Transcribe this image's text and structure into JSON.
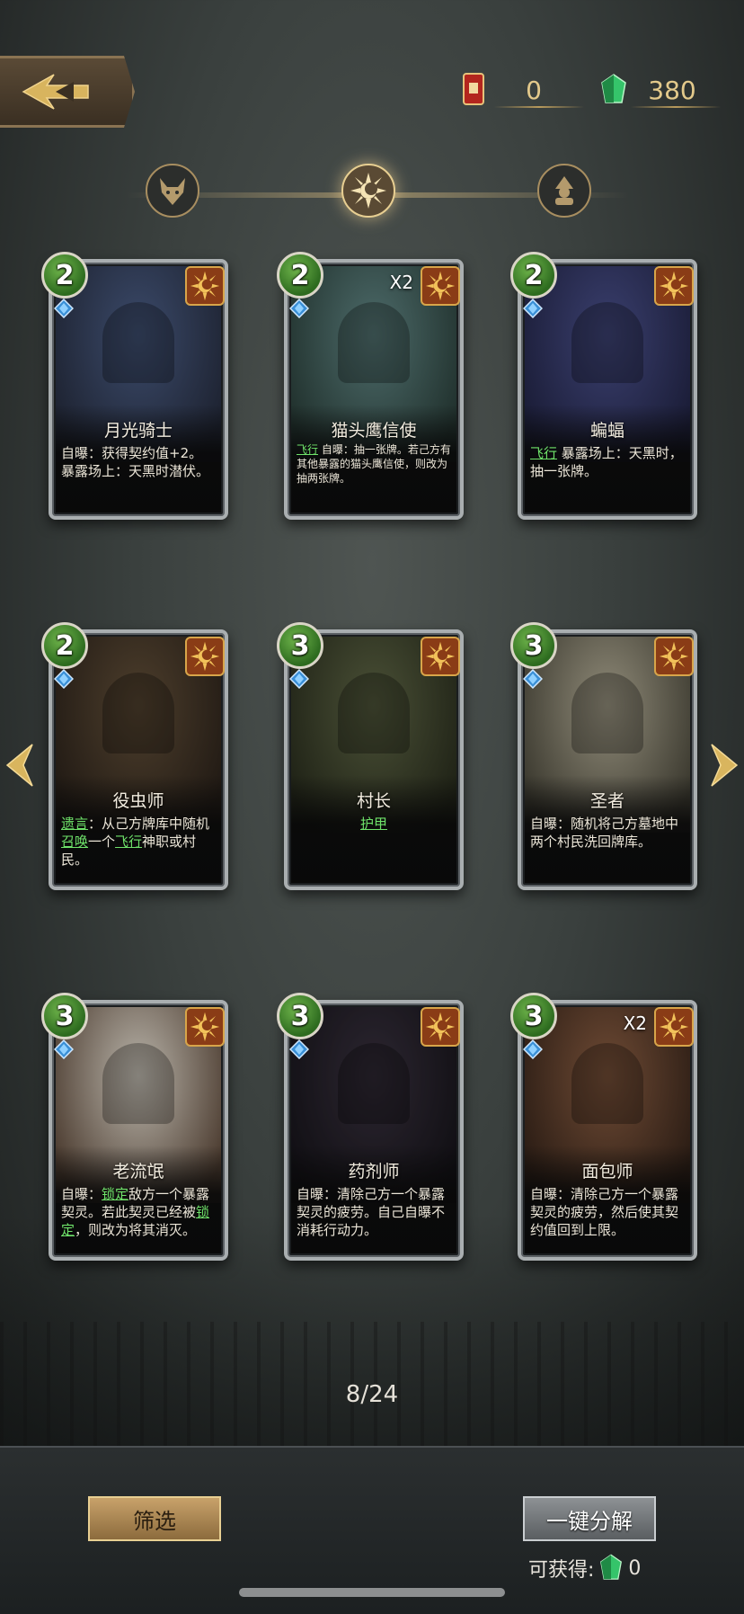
{
  "header": {
    "back_icon": "back-arrow-icon",
    "card_pack": {
      "icon": "card-pack-icon",
      "value": "0"
    },
    "gems": {
      "icon": "green-gem-icon",
      "value": "380"
    }
  },
  "faction_filters": [
    {
      "icon": "wolf-icon",
      "active": false
    },
    {
      "icon": "sun-moon-icon",
      "active": true
    },
    {
      "icon": "villager-icon",
      "active": false
    }
  ],
  "cards": [
    {
      "cost": "2",
      "name": "月光骑士",
      "multiplier": "",
      "desc": [
        {
          "t": "自曝：获得契约值+2。暴露场上：天黑时潜伏。",
          "k": false
        }
      ],
      "art": [
        "#3b4a6a",
        "#1d2230"
      ]
    },
    {
      "cost": "2",
      "name": "猫头鹰信使",
      "multiplier": "X2",
      "desc": [
        {
          "t": "飞行",
          "k": true
        },
        {
          "t": " 自曝：抽一张牌。若己方有其他暴露的猫头鹰信使，则改为抽两张牌。",
          "k": false
        }
      ],
      "small": true,
      "art": [
        "#4d6b6a",
        "#20302c"
      ]
    },
    {
      "cost": "2",
      "name": "蝙蝠",
      "multiplier": "",
      "desc": [
        {
          "t": "飞行",
          "k": true
        },
        {
          "t": " 暴露场上：天黑时，抽一张牌。",
          "k": false
        }
      ],
      "art": [
        "#3a3f6e",
        "#1a1c36"
      ]
    },
    {
      "cost": "2",
      "name": "役虫师",
      "multiplier": "",
      "desc": [
        {
          "t": "遗言",
          "k": true
        },
        {
          "t": "：从己方牌库中随机",
          "k": false
        },
        {
          "t": "召唤",
          "k": true
        },
        {
          "t": "一个",
          "k": false
        },
        {
          "t": "飞行",
          "k": true
        },
        {
          "t": "神职或村民。",
          "k": false
        }
      ],
      "art": [
        "#4d3e2c",
        "#211a14"
      ]
    },
    {
      "cost": "3",
      "name": "村长",
      "multiplier": "",
      "desc": [
        {
          "t": "护甲",
          "k": true
        }
      ],
      "center": true,
      "art": [
        "#4a5036",
        "#1f2216"
      ]
    },
    {
      "cost": "3",
      "name": "圣者",
      "multiplier": "",
      "desc": [
        {
          "t": "自曝：随机将己方墓地中两个村民洗回牌库。",
          "k": false
        }
      ],
      "art": [
        "#8f8a78",
        "#3a382e"
      ]
    },
    {
      "cost": "3",
      "name": "老流氓",
      "multiplier": "",
      "desc": [
        {
          "t": "自曝：",
          "k": false
        },
        {
          "t": "锁定",
          "k": true
        },
        {
          "t": "敌方一个暴露契灵。若此契灵已经被",
          "k": false
        },
        {
          "t": "锁定",
          "k": true
        },
        {
          "t": "，则改为将其消灭。",
          "k": false
        }
      ],
      "art": [
        "#b9b4aa",
        "#4a3a2e"
      ]
    },
    {
      "cost": "3",
      "name": "药剂师",
      "multiplier": "",
      "desc": [
        {
          "t": "自曝：清除己方一个暴露契灵的疲劳。自己自曝不消耗行动力。",
          "k": false
        }
      ],
      "dim": true,
      "art": [
        "#3a3240",
        "#16141a"
      ]
    },
    {
      "cost": "3",
      "name": "面包师",
      "multiplier": "X2",
      "desc": [
        {
          "t": "自曝：清除己方一个暴露契灵的疲劳，然后使其契约值回到上限。",
          "k": false
        }
      ],
      "art": [
        "#6e4a34",
        "#2a1c14"
      ]
    }
  ],
  "navigation": {
    "prev_icon": "left-arrow-icon",
    "next_icon": "right-arrow-icon"
  },
  "pager": "8/24",
  "bottom_bar": {
    "filter_label": "筛选",
    "disenchant_label": "一键分解",
    "gain_label": "可获得:",
    "gain_icon": "green-gem-icon",
    "gain_value": "0"
  }
}
